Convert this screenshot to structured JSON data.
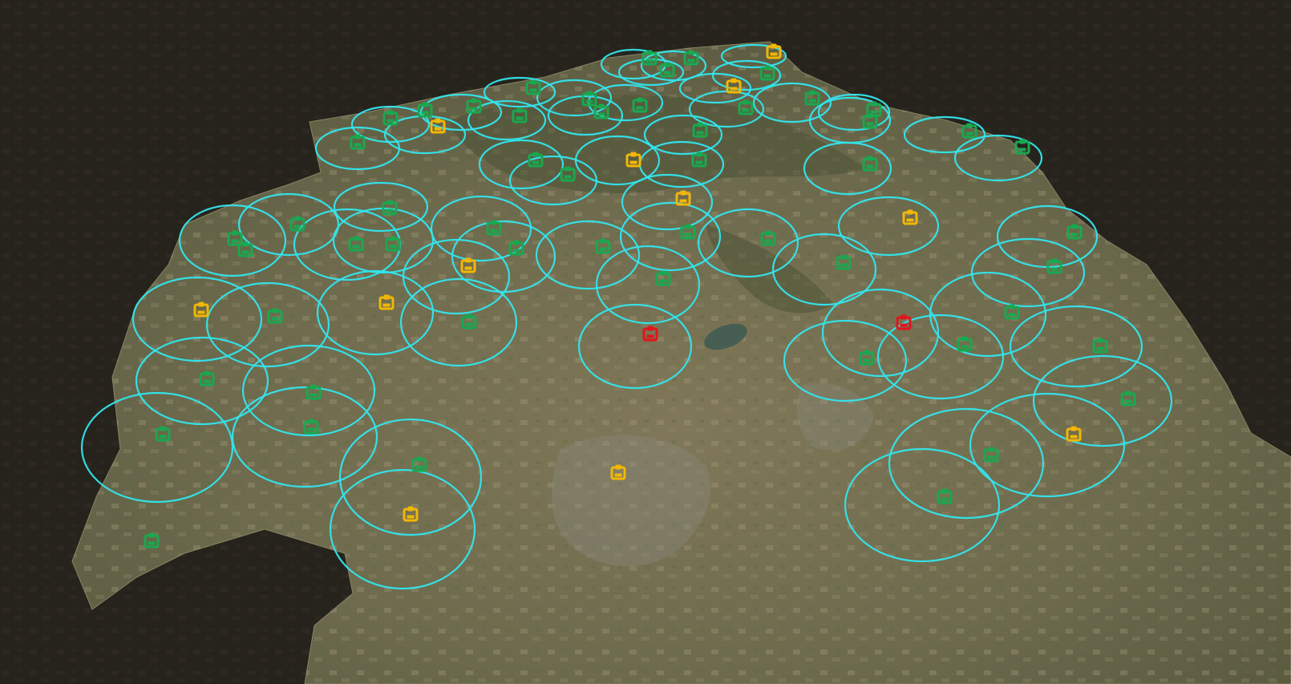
{
  "map": {
    "view": "3d-satellite-terrain",
    "colors": {
      "background": "#26231c",
      "terrain": "#6f6a4e",
      "coverage_ring": "#31e6ee",
      "status_normal": "#19a84f",
      "status_warning": "#f2b705",
      "status_alarm": "#e3141b"
    },
    "icon": "station-icon",
    "station_counts": {
      "normal": 59,
      "warning": 13,
      "alarm": 2
    }
  }
}
